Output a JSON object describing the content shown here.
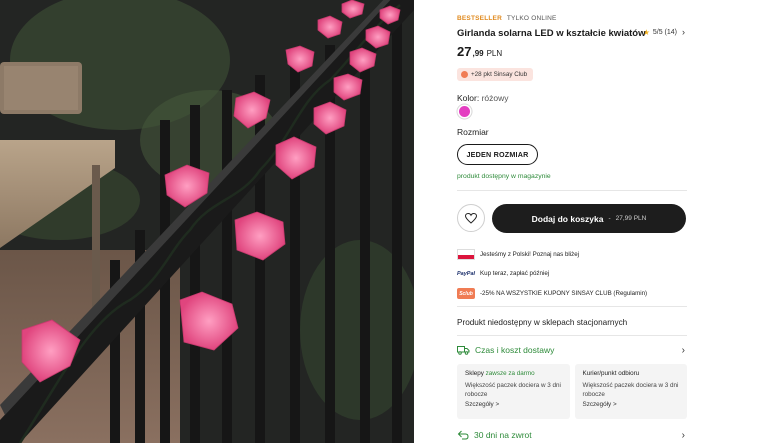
{
  "product": {
    "badge_bestseller": "BESTSELLER",
    "badge_online": "TYLKO ONLINE",
    "title": "Girlanda solarna LED w kształcie kwiatów",
    "rating": "5/5 (14)",
    "price_int": "27",
    "price_dec": ",99",
    "price_currency": "PLN",
    "club_points": "+28 pkt Sinsay Club",
    "color_label": "Kolor:",
    "color_value": "różowy",
    "color_swatch": "#e43ec1",
    "size_label": "Rozmiar",
    "size_option": "JEDEN ROZMIAR",
    "stock_status": "produkt dostępny w magazynie"
  },
  "actions": {
    "wishlist_icon": "heart-icon",
    "add_to_cart": "Dodaj do koszyka",
    "add_to_cart_separator": "-",
    "add_to_cart_price": "27,99 PLN"
  },
  "info": [
    {
      "icon": "poland-flag-icon",
      "text": "Jesteśmy z Polski! Poznaj nas bliżej"
    },
    {
      "icon": "paypal-icon",
      "icon_text": "PayPal",
      "text": "Kup teraz, zapłać później"
    },
    {
      "icon": "sinsay-club-icon",
      "icon_text": "Sclub",
      "text": "-25% NA WSZYSTKIE KUPONY SINSAY CLUB (Regulamin)"
    }
  ],
  "unavailable": "Produkt niedostępny w sklepach stacjonarnych",
  "delivery": {
    "title": "Czas i koszt dostawy",
    "stores_title": "Sklepy",
    "stores_free": "zawsze za darmo",
    "stores_text": "Większość paczek dociera w 3 dni robocze",
    "stores_more": "Szczegóły >",
    "courier_title": "Kurier/punkt odbioru",
    "courier_text": "Większość paczek dociera w 3 dni robocze",
    "courier_more": "Szczegóły >"
  },
  "returns": {
    "title": "30 dni na zwrot"
  },
  "colors": {
    "accent_green": "#2e8b3a",
    "button_dark": "#1d1d1d",
    "bestseller_orange": "#e08a1e",
    "club_bg": "#fbe4df"
  }
}
